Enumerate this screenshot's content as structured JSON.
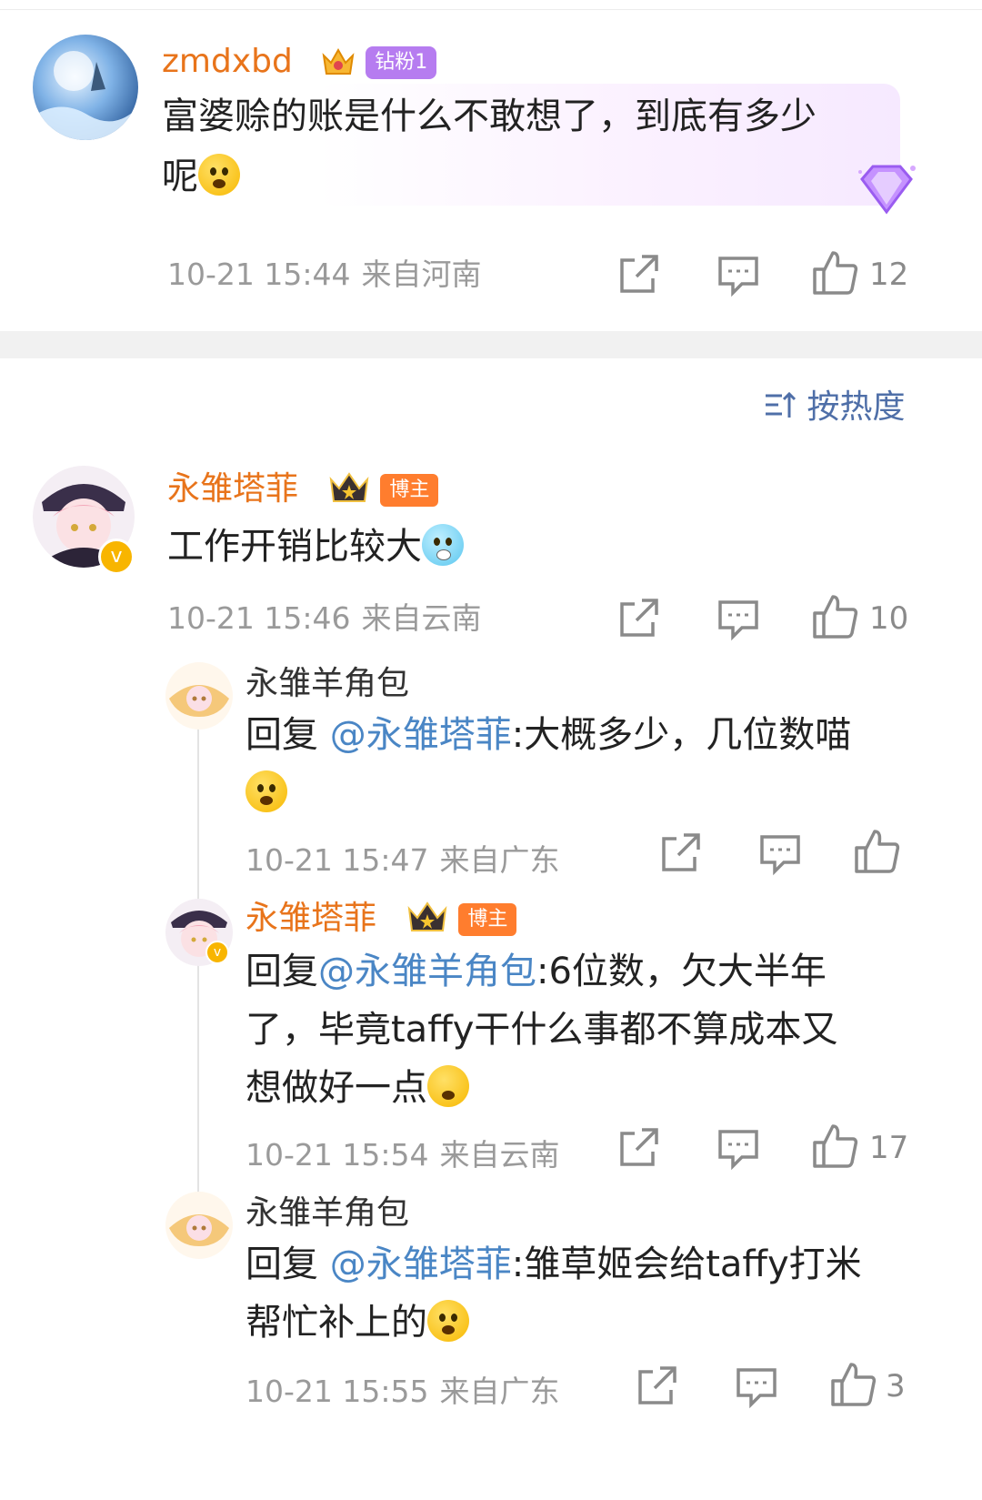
{
  "comments": [
    {
      "username": "zmdxbd",
      "badge": "钻粉1",
      "text": "富婆赊的账是什么不敢想了，到底有多少",
      "text_line2": "呢",
      "time": "10-21 15:44",
      "location": "来自河南",
      "likes": "12"
    }
  ],
  "sort": {
    "label": "按热度"
  },
  "main_comment": {
    "username": "永雏塔菲",
    "badge": "博主",
    "text": "工作开销比较大",
    "time": "10-21 15:46",
    "location": "来自云南",
    "likes": "10"
  },
  "replies": [
    {
      "username": "永雏羊角包",
      "prefix": "回复 ",
      "mention": "@永雏塔菲",
      "text": ":大概多少，几位数喵",
      "time": "10-21 15:47",
      "location": "来自广东",
      "likes": ""
    },
    {
      "username": "永雏塔菲",
      "badge": "博主",
      "prefix": "回复",
      "mention": "@永雏羊角包",
      "text": ":6位数，欠大半年",
      "text_line2": "了，毕竟taffy干什么事都不算成本又",
      "text_line3": "想做好一点",
      "time": "10-21 15:54",
      "location": "来自云南",
      "likes": "17"
    },
    {
      "username": "永雏羊角包",
      "prefix": "回复 ",
      "mention": "@永雏塔菲",
      "text": ":雏草姬会给taffy打米",
      "text_line2": "帮忙补上的",
      "time": "10-21 15:55",
      "location": "来自广东",
      "likes": "3"
    }
  ],
  "colors": {
    "name_orange": "#e8741b",
    "mention_blue": "#4a86c5",
    "meta_grey": "#9a9a9a",
    "sort_blue": "#4f6fa8"
  }
}
